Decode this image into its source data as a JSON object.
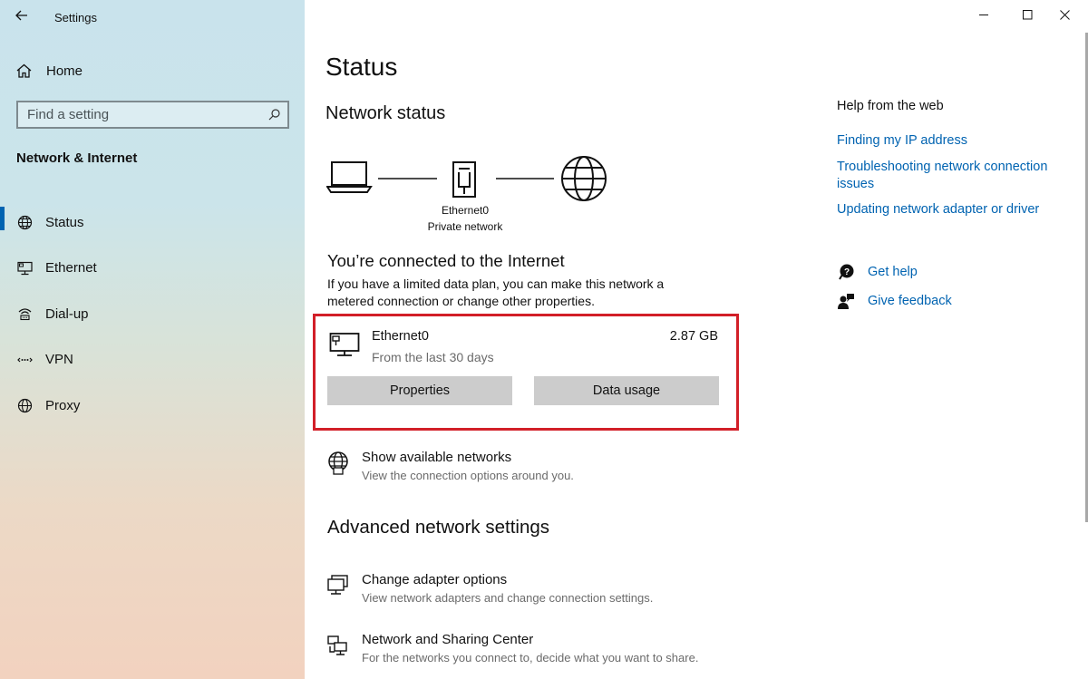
{
  "window": {
    "title": "Settings"
  },
  "sidebar": {
    "home_label": "Home",
    "search": {
      "placeholder": "Find a setting"
    },
    "section_title": "Network & Internet",
    "items": [
      {
        "label": "Status",
        "icon": "globe-status-icon",
        "active": true
      },
      {
        "label": "Ethernet",
        "icon": "ethernet-monitor-icon",
        "active": false
      },
      {
        "label": "Dial-up",
        "icon": "dialup-phone-icon",
        "active": false
      },
      {
        "label": "VPN",
        "icon": "vpn-icon",
        "active": false
      },
      {
        "label": "Proxy",
        "icon": "globe-icon",
        "active": false
      }
    ]
  },
  "main": {
    "title": "Status",
    "network_status_heading": "Network status",
    "diagram": {
      "adapter_name": "Ethernet0",
      "network_type": "Private network"
    },
    "connected_title": "You’re connected to the Internet",
    "connected_desc": "If you have a limited data plan, you can make this network a metered connection or change other properties.",
    "connection_card": {
      "name": "Ethernet0",
      "period": "From the last 30 days",
      "data_used": "2.87 GB",
      "properties_label": "Properties",
      "data_usage_label": "Data usage"
    },
    "show_networks": {
      "title": "Show available networks",
      "desc": "View the connection options around you."
    },
    "advanced_heading": "Advanced network settings",
    "advanced_items": [
      {
        "title": "Change adapter options",
        "desc": "View network adapters and change connection settings."
      },
      {
        "title": "Network and Sharing Center",
        "desc": "For the networks you connect to, decide what you want to share."
      }
    ]
  },
  "help_panel": {
    "title": "Help from the web",
    "links": [
      "Finding my IP address",
      "Troubleshooting network connection issues",
      "Updating network adapter or driver"
    ],
    "get_help": "Get help",
    "give_feedback": "Give feedback"
  },
  "colors": {
    "accent": "#0063b1",
    "highlight_border": "#d21f28",
    "button_bg": "#cccccc"
  }
}
